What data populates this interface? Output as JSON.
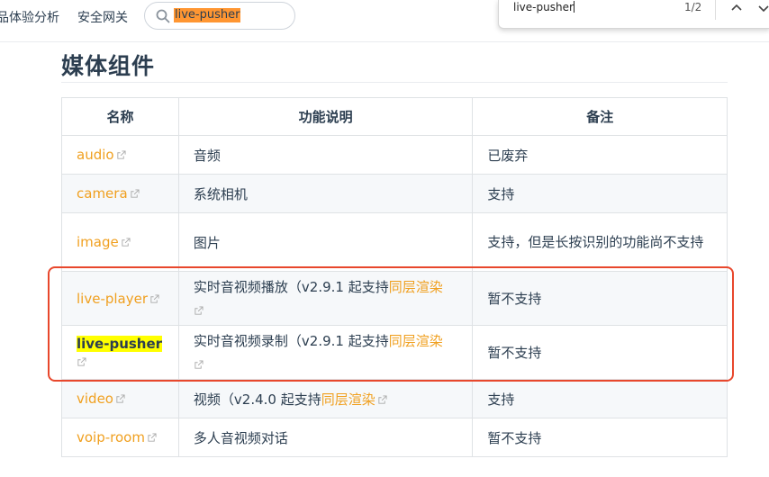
{
  "nav": {
    "link1": "品体验分析",
    "link2": "安全网关",
    "search_value": "live-pusher"
  },
  "findbar": {
    "query": "live-pusher",
    "count": "1/2"
  },
  "heading": "媒体组件",
  "table": {
    "headers": [
      "名称",
      "功能说明",
      "备注"
    ],
    "rows": [
      {
        "name": "audio",
        "desc": "音频",
        "note": "已废弃"
      },
      {
        "name": "camera",
        "desc": "系统相机",
        "note": "支持"
      },
      {
        "name": "image",
        "desc": "图片",
        "note": "支持，但是长按识别的功能尚不支持"
      },
      {
        "name": "live-player",
        "desc": "实时音视频播放（v2.9.1 起支持",
        "desc_link": "同层渲染",
        "note": "暂不支持"
      },
      {
        "name": "live-pusher",
        "desc": "实时音视频录制（v2.9.1 起支持",
        "desc_link": "同层渲染",
        "note": "暂不支持"
      },
      {
        "name": "video",
        "desc": "视频（v2.4.0 起支持",
        "desc_link": "同层渲染",
        "note": "支持"
      },
      {
        "name": "voip-room",
        "desc": "多人音视频对话",
        "note": "暂不支持"
      }
    ]
  },
  "colors": {
    "link": "#f0a020",
    "highlight": "#ffff00",
    "search_highlight": "#ff9632",
    "annotation": "#e8472c"
  }
}
